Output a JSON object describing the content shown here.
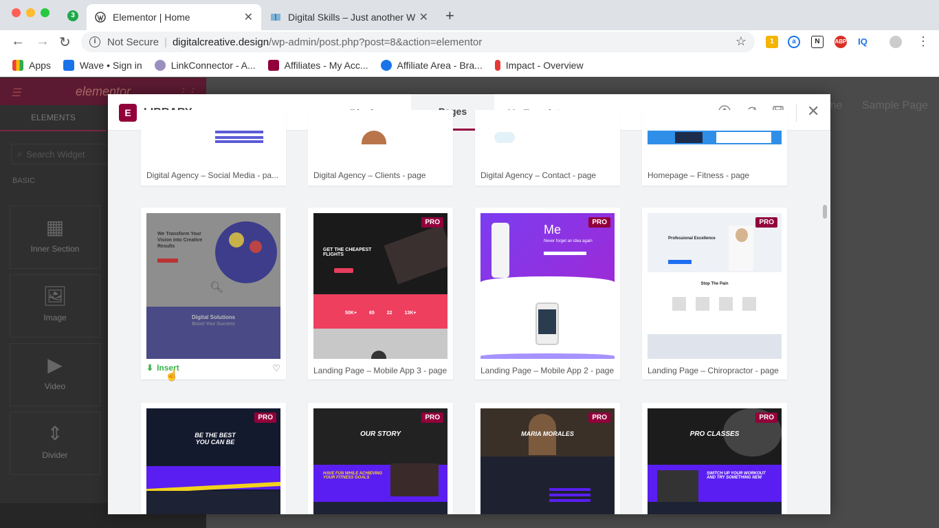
{
  "browser": {
    "tab_count_badge": "3",
    "tabs": [
      {
        "title": "Elementor | Home",
        "active": true
      },
      {
        "title": "Digital Skills – Just another Wo",
        "active": false
      }
    ],
    "url": {
      "security_label": "Not Secure",
      "host": "digitalcreative.design",
      "path": "/wp-admin/post.php?post=8&action=elementor"
    },
    "extension_badge": "1",
    "bookmarks": [
      {
        "label": "Apps",
        "color": "#ea4335"
      },
      {
        "label": "Wave • Sign in",
        "color": "#1a73e8"
      },
      {
        "label": "LinkConnector - A...",
        "color": "#9b8fc0"
      },
      {
        "label": "Affiliates - My Acc...",
        "color": "#92003b"
      },
      {
        "label": "Affiliate Area - Bra...",
        "color": "#1a73e8"
      },
      {
        "label": "Impact - Overview",
        "color": "#e53935"
      }
    ]
  },
  "editor": {
    "logo": "elementor",
    "panel_tab": "ELEMENTS",
    "search_placeholder": "Search Widget",
    "category": "BASIC",
    "widgets": [
      {
        "label": "Inner Section",
        "icon": "columns-icon"
      },
      {
        "label": "Image",
        "icon": "image-icon"
      },
      {
        "label": "Video",
        "icon": "video-icon"
      },
      {
        "label": "Divider",
        "icon": "divider-icon"
      }
    ],
    "canvas_nav": [
      "me",
      "Sample Page"
    ]
  },
  "library": {
    "title": "LIBRARY",
    "tabs": [
      "Blocks",
      "Pages",
      "My Templates"
    ],
    "active_tab": "Pages",
    "insert_label": "Insert",
    "pro_label": "PRO",
    "rows": [
      [
        {
          "caption": "Digital Agency – Social Media - pa...",
          "pro": false
        },
        {
          "caption": "Digital Agency – Clients - page",
          "pro": false
        },
        {
          "caption": "Digital Agency – Contact - page",
          "pro": false
        },
        {
          "caption": "Homepage – Fitness - page",
          "pro": false
        }
      ],
      [
        {
          "caption": "",
          "pro": false,
          "hovered": true,
          "thumb_heading": "We Transform Your Vision into Creative Results",
          "thumb_sub": "Digital Solutions",
          "thumb_sub2": "Boost Your Success"
        },
        {
          "caption": "Landing Page – Mobile App 3 - page",
          "pro": true,
          "thumb_heading": "GET THE CHEAPEST FLIGHTS",
          "thumb_stats": [
            "50K+",
            "65",
            "22",
            "13K+"
          ]
        },
        {
          "caption": "Landing Page – Mobile App 2 - page",
          "pro": true,
          "thumb_heading": "Me",
          "thumb_sub": "Never forget an idea again"
        },
        {
          "caption": "Landing Page – Chiropractor - page",
          "pro": true,
          "thumb_heading": "Professional Excellence",
          "thumb_sub": "Stop The Pain"
        }
      ],
      [
        {
          "caption": "",
          "pro": true,
          "thumb_heading": "BE THE BEST YOU CAN BE"
        },
        {
          "caption": "",
          "pro": true,
          "thumb_heading": "OUR STORY",
          "thumb_sub": "HAVE FUN WHILE ACHIEVING YOUR FITNESS GOALS"
        },
        {
          "caption": "",
          "pro": true,
          "thumb_heading": "MARIA MORALES"
        },
        {
          "caption": "",
          "pro": true,
          "thumb_heading": "PRO CLASSES",
          "thumb_sub": "SWITCH UP YOUR WORKOUT AND TRY SOMETHING NEW"
        }
      ]
    ]
  },
  "colors": {
    "accent": "#92003b",
    "insert_green": "#39b54a"
  }
}
